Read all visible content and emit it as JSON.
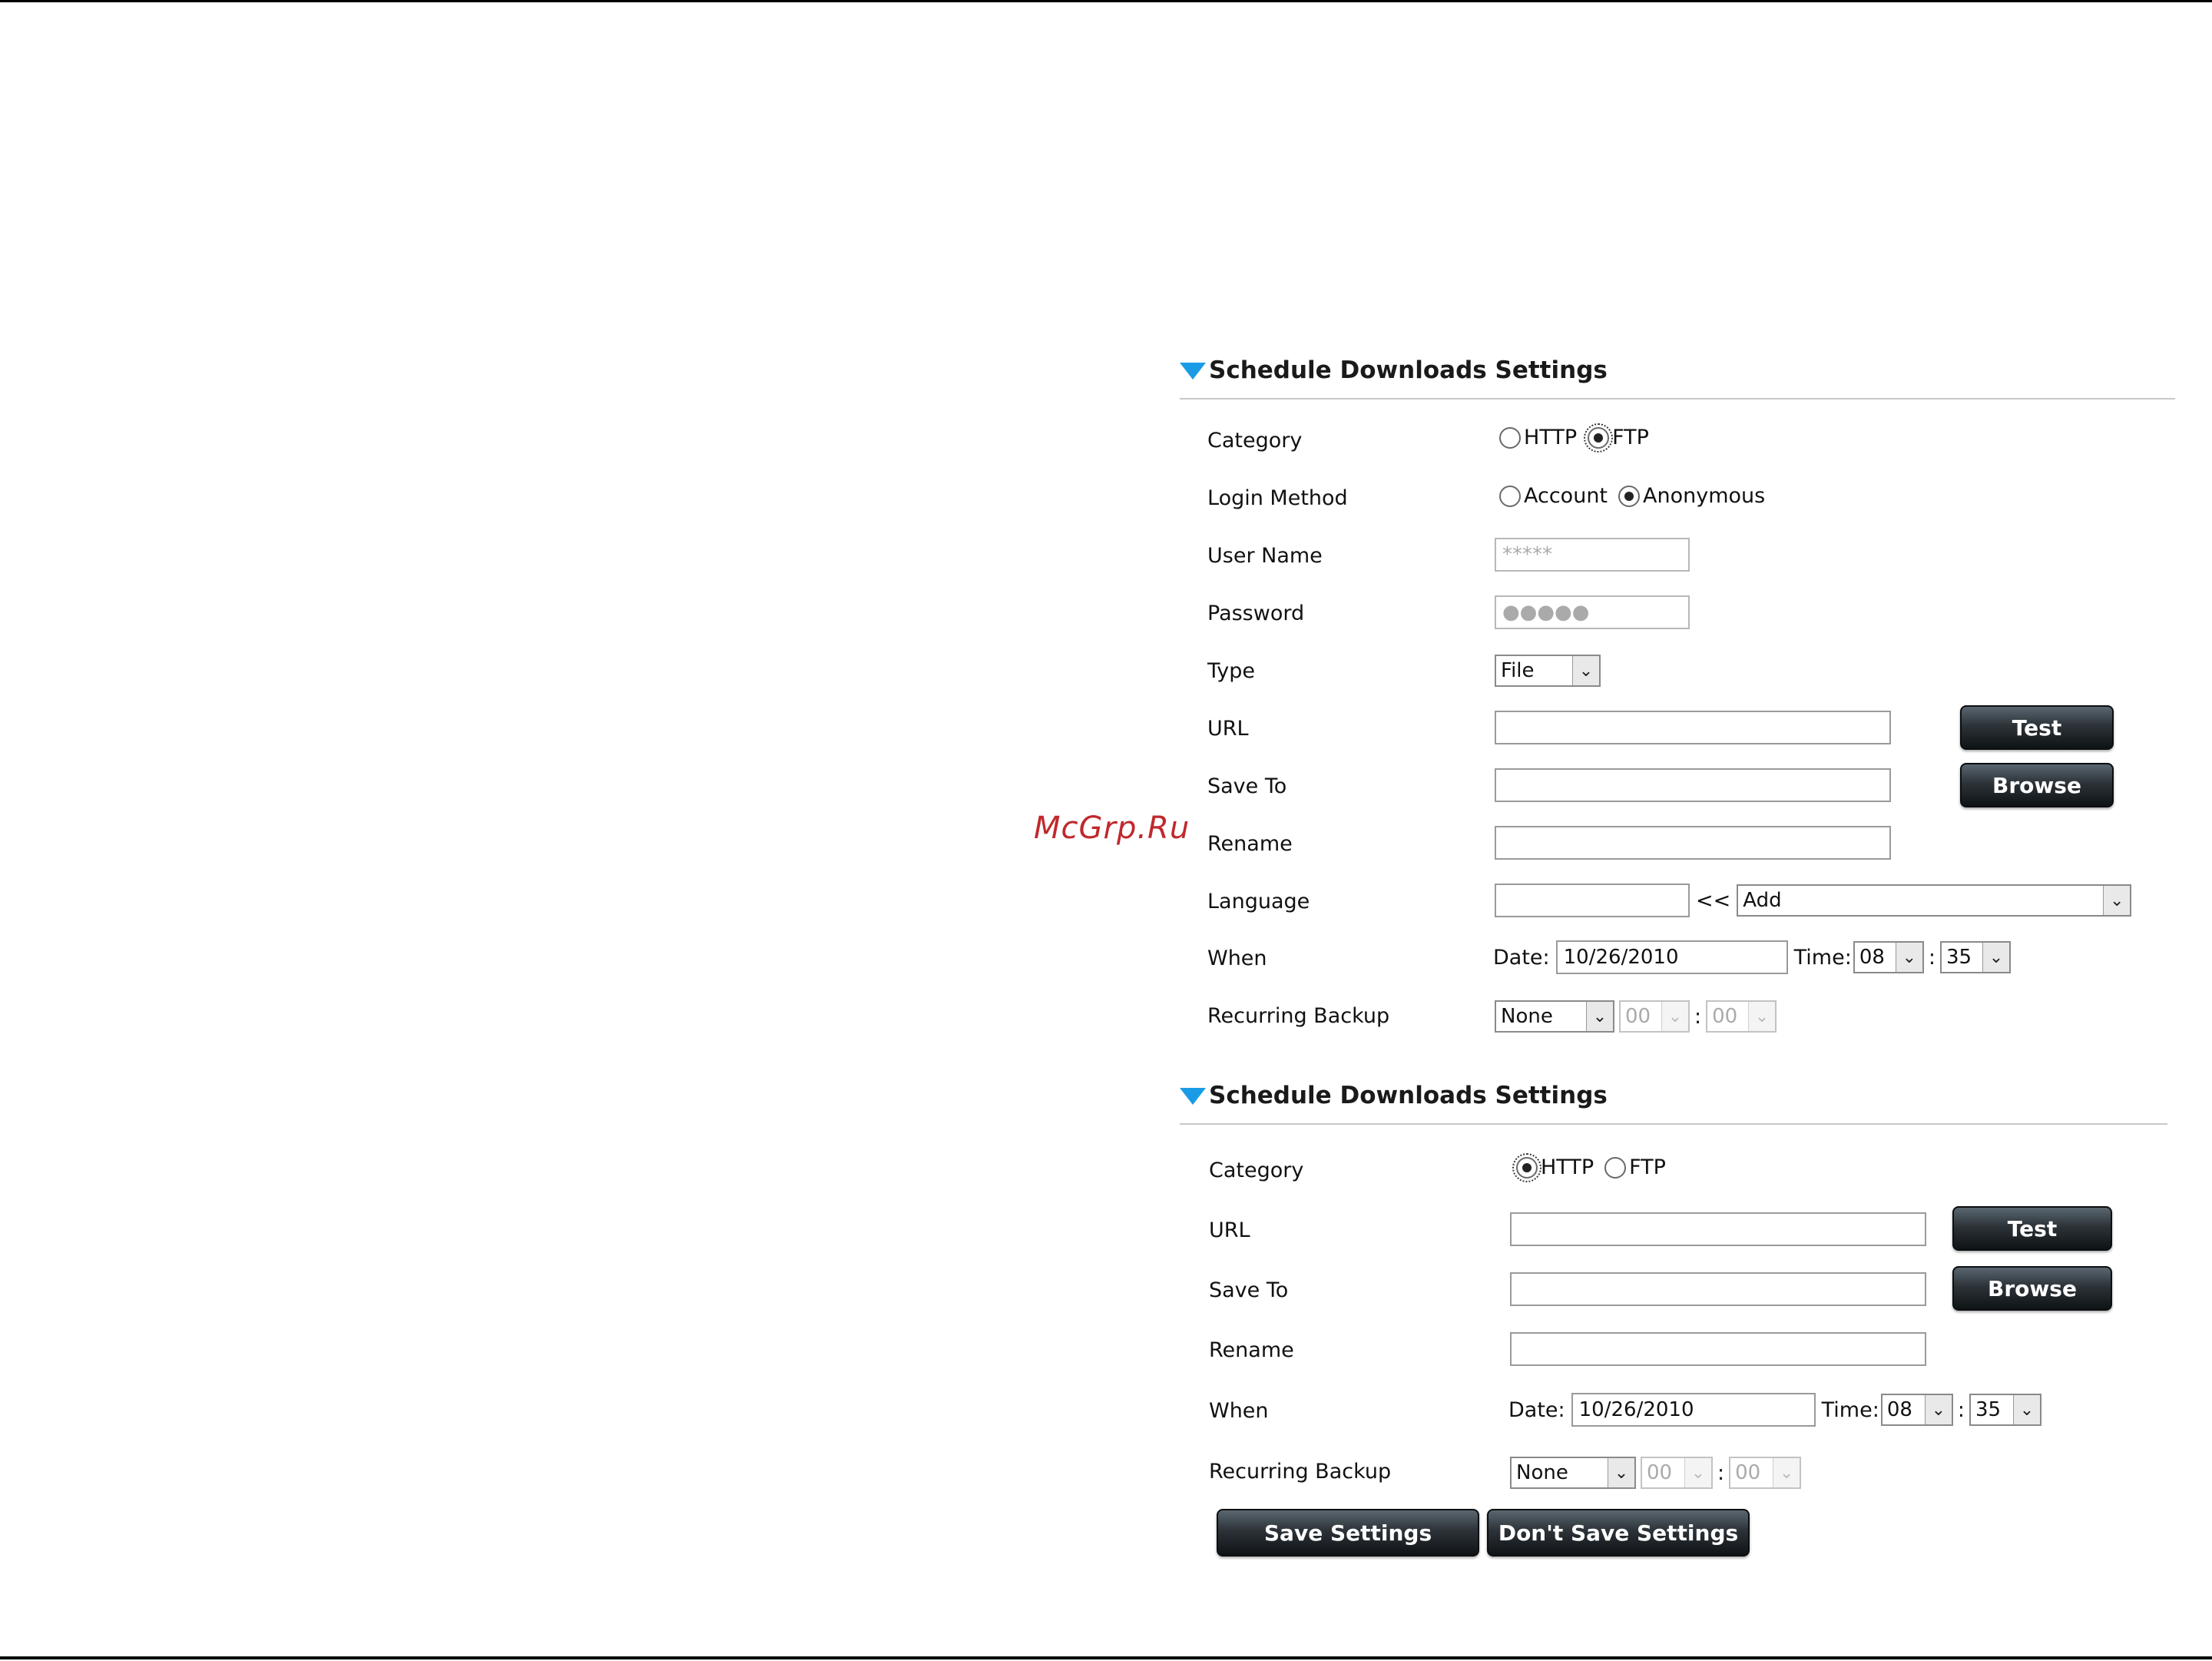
{
  "watermark": "McGrp.Ru",
  "section1": {
    "title": "Schedule Downloads Settings",
    "category": {
      "label": "Category",
      "options": [
        "HTTP",
        "FTP"
      ],
      "selected": "FTP"
    },
    "login_method": {
      "label": "Login Method",
      "options": [
        "Account",
        "Anonymous"
      ],
      "selected": "Anonymous"
    },
    "user_name": {
      "label": "User Name",
      "value": "*****"
    },
    "password": {
      "label": "Password",
      "value": "●●●●●"
    },
    "type": {
      "label": "Type",
      "value": "File"
    },
    "url": {
      "label": "URL",
      "value": "",
      "button": "Test"
    },
    "save_to": {
      "label": "Save To",
      "value": "",
      "button": "Browse"
    },
    "rename": {
      "label": "Rename",
      "value": ""
    },
    "language": {
      "label": "Language",
      "value": "",
      "arrow": "<<",
      "select": "Add"
    },
    "when": {
      "label": "When",
      "date_label": "Date:",
      "date": "10/26/2010",
      "time_label": "Time:",
      "hour": "08",
      "colon": ":",
      "minute": "35"
    },
    "recurring": {
      "label": "Recurring Backup",
      "value": "None",
      "hour": "00",
      "colon": ":",
      "minute": "00"
    }
  },
  "section2": {
    "title": "Schedule Downloads Settings",
    "category": {
      "label": "Category",
      "options": [
        "HTTP",
        "FTP"
      ],
      "selected": "HTTP"
    },
    "url": {
      "label": "URL",
      "value": "",
      "button": "Test"
    },
    "save_to": {
      "label": "Save To",
      "value": "",
      "button": "Browse"
    },
    "rename": {
      "label": "Rename",
      "value": ""
    },
    "when": {
      "label": "When",
      "date_label": "Date:",
      "date": "10/26/2010",
      "time_label": "Time:",
      "hour": "08",
      "colon": ":",
      "minute": "35"
    },
    "recurring": {
      "label": "Recurring Backup",
      "value": "None",
      "hour": "00",
      "colon": ":",
      "minute": "00"
    }
  },
  "footer": {
    "save": "Save Settings",
    "dont_save": "Don't Save Settings"
  },
  "colors": {
    "accent_triangle": "#1a9be6",
    "watermark": "#c0282d",
    "button_dark": "#1c2226"
  },
  "icons": {
    "section_marker": "triangle-down-icon",
    "select_arrow": "chevron-down-icon"
  }
}
